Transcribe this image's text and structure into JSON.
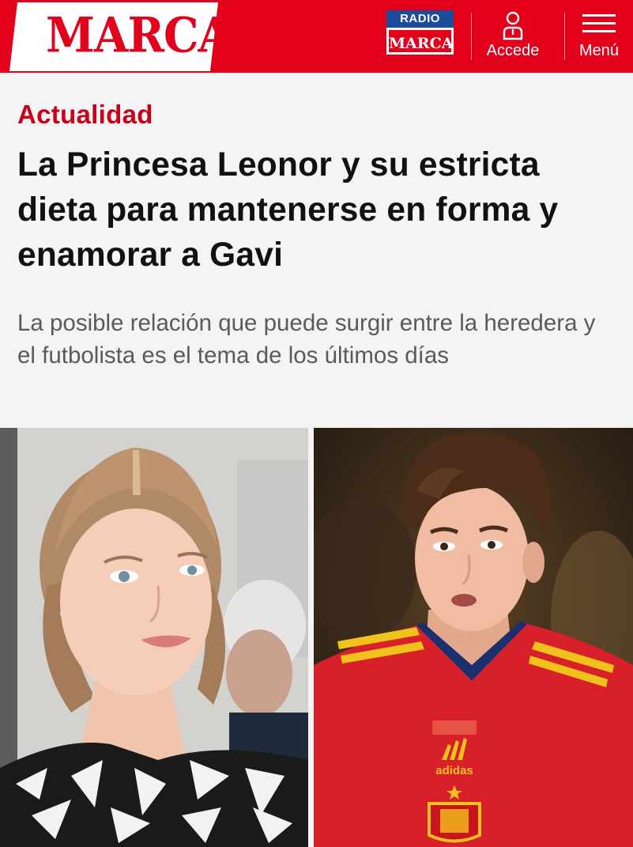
{
  "header": {
    "logo": "MARCA",
    "radio_badge": {
      "top_label": "RADIO",
      "bottom_label": "MARCA"
    },
    "login_label": "Accede",
    "menu_label": "Menú",
    "colors": {
      "brand_red": "#e2001a",
      "radio_blue": "#1b4c9c"
    },
    "icons": {
      "login": "user-icon",
      "menu": "hamburger-icon"
    }
  },
  "article": {
    "section": "Actualidad",
    "headline": "La Princesa Leonor y su estricta dieta para mantenerse en forma y enamorar a Gavi",
    "subheadline": "La posible relación que puede surgir entre la heredera y el futbolista es el tema de los últimos días",
    "shirt_brand": "adidas"
  }
}
